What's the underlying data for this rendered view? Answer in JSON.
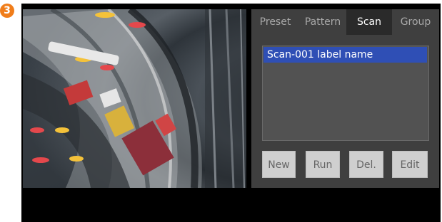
{
  "step_badge": "3",
  "tabs": [
    {
      "label": "Preset",
      "active": false
    },
    {
      "label": "Pattern",
      "active": false
    },
    {
      "label": "Scan",
      "active": true
    },
    {
      "label": "Group",
      "active": false
    }
  ],
  "scan_list": {
    "items": [
      "Scan-001 label name"
    ],
    "selected_index": 0
  },
  "buttons": {
    "new_label": "New",
    "run_label": "Run",
    "delete_label": "Del.",
    "edit_label": "Edit"
  },
  "colors": {
    "badge": "#f07d1a",
    "selection": "#2f4fb5",
    "panel_background": "#3f3f3f",
    "active_tab": "#2a2a2a"
  }
}
